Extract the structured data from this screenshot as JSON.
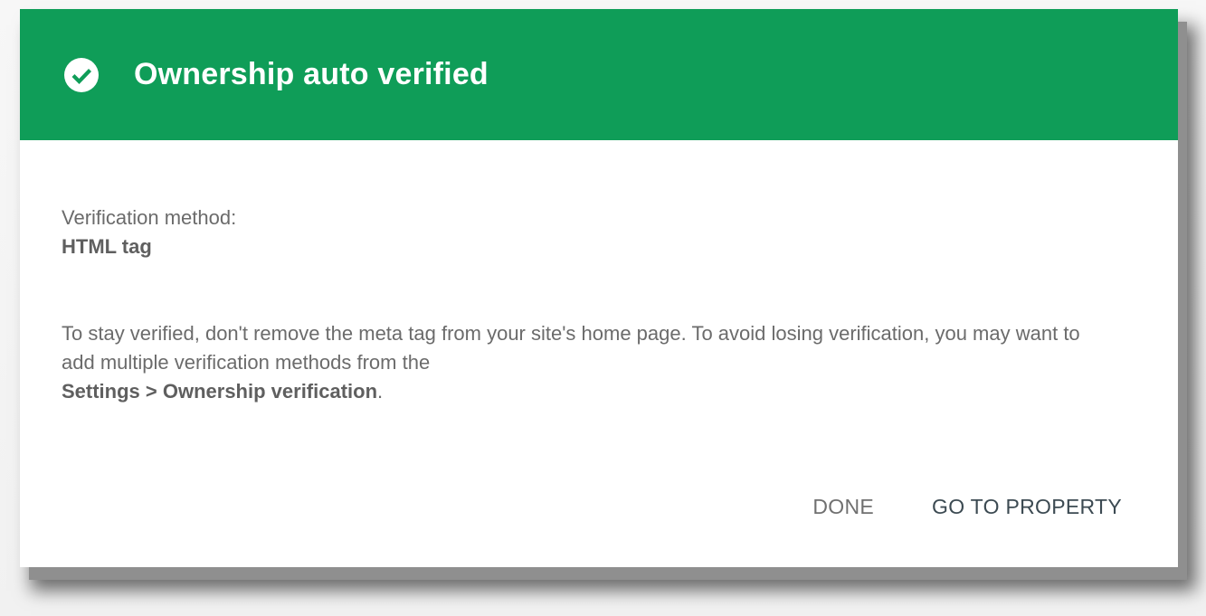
{
  "dialog": {
    "title": "Ownership auto verified",
    "header_color": "#0f9d58",
    "icon": "check-circle-icon"
  },
  "body": {
    "method_label": "Verification method:",
    "method_value": "HTML tag",
    "note_text": "To stay verified, don't remove the meta tag from your site's home page. To avoid losing verification, you may want to add multiple verification methods from the",
    "note_link": "Settings > Ownership verification",
    "note_end": "."
  },
  "actions": {
    "done_label": "DONE",
    "go_label": "GO TO PROPERTY"
  }
}
